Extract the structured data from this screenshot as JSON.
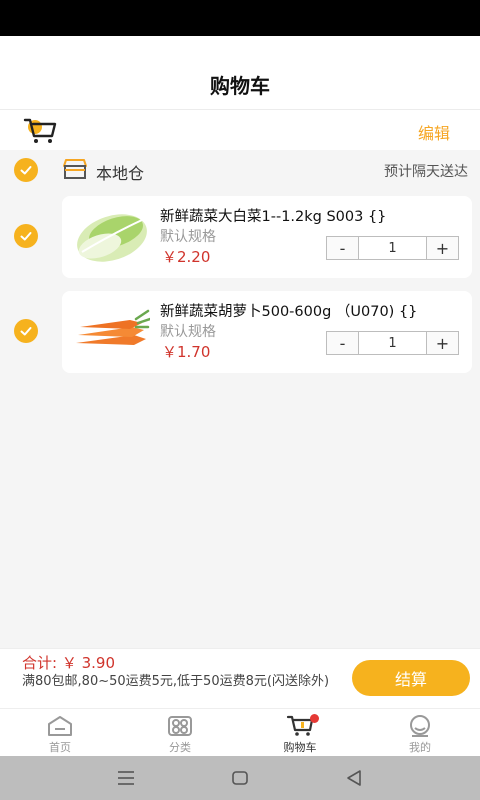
{
  "header": {
    "title": "购物车",
    "edit_label": "编辑"
  },
  "warehouse": {
    "name": "本地仓",
    "delivery_note": "预计隔天送达"
  },
  "items": [
    {
      "name": "新鲜蔬菜大白菜1--1.2kg S003  {}",
      "spec": "默认规格",
      "price": "￥2.20",
      "quantity": "1",
      "minus": "-",
      "plus": "+"
    },
    {
      "name": "新鲜蔬菜胡萝卜500-600g （U070) {}",
      "spec": "默认规格",
      "price": "￥1.70",
      "quantity": "1",
      "minus": "-",
      "plus": "+"
    }
  ],
  "footer": {
    "total": "合计: ￥ 3.90",
    "shipping_note": "满80包邮,80~50运费5元,低于50运费8元(闪送除外)",
    "checkout_label": "结算"
  },
  "tabbar": [
    {
      "label": "首页",
      "icon": "home-icon"
    },
    {
      "label": "分类",
      "icon": "category-icon"
    },
    {
      "label": "购物车",
      "icon": "cart-icon"
    },
    {
      "label": "我的",
      "icon": "profile-icon"
    }
  ],
  "colors": {
    "accent": "#f6b21e",
    "price": "#d0342c"
  }
}
